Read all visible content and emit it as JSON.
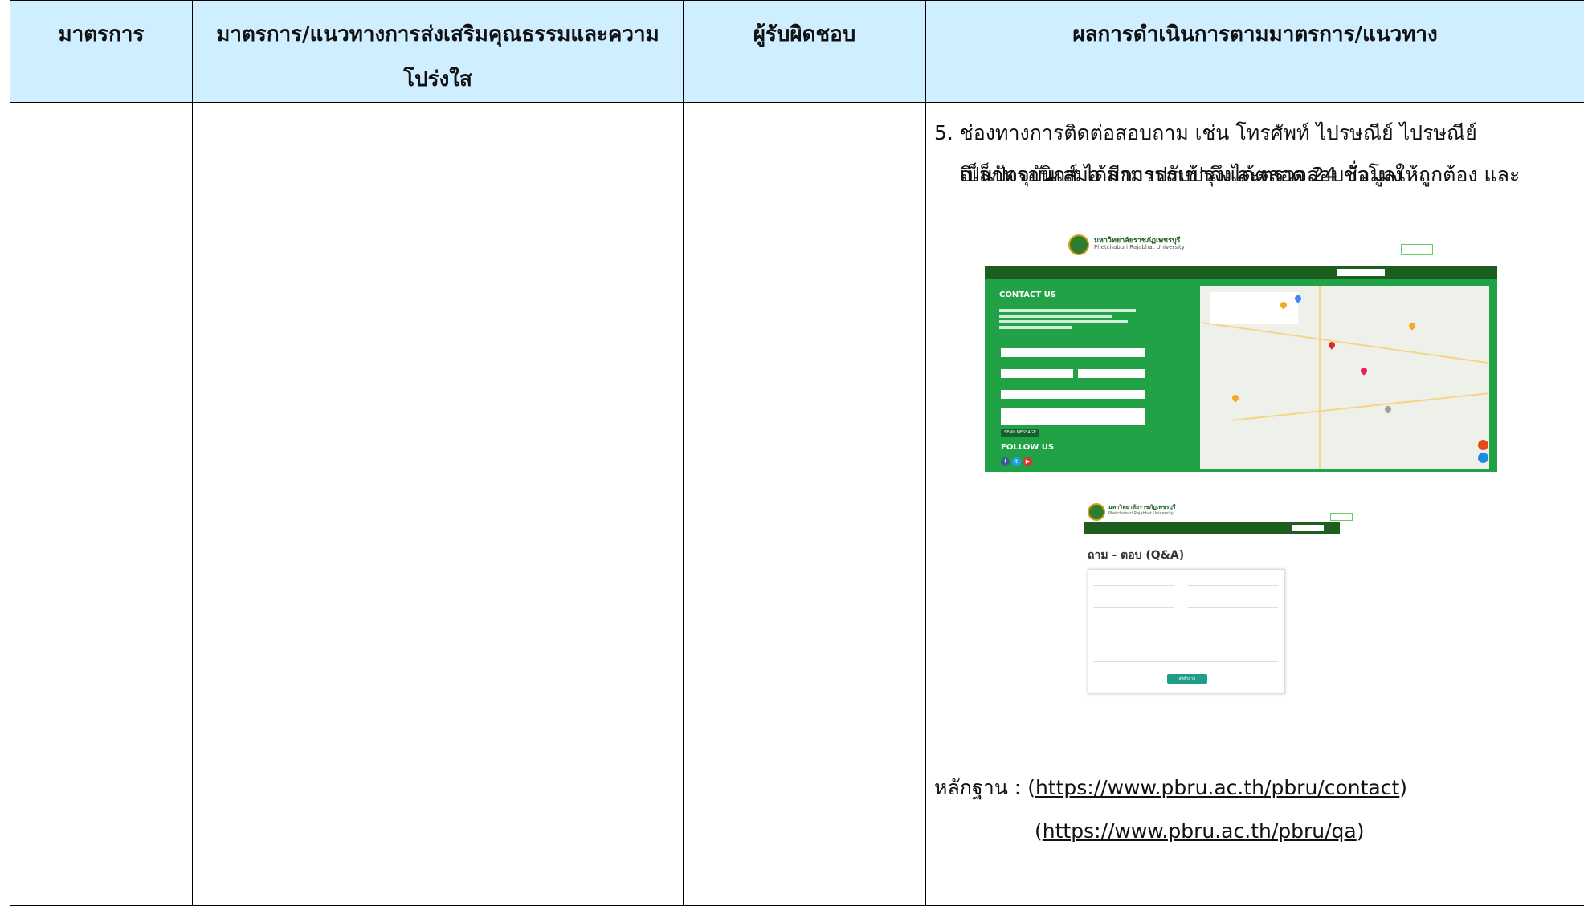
{
  "table": {
    "headers": {
      "col1": "มาตรการ",
      "col2": "มาตรการ/แนวทางการส่งเสริมคุณธรรมและความโปร่งใส",
      "col3": "ผู้รับผิดชอบ",
      "col4": "ผลการดำเนินการตามมาตรการ/แนวทาง"
    },
    "paragraph": {
      "line1": "5. ช่องทางการติดต่อสอบถาม เช่น โทรศัพท์  ไปรษณีย์  ไปรษณีย์",
      "line2": "อิเล็กทรอนิกส์ ได้มีการปรับปรุงและตรวจสอบข้อมูลให้ถูกต้อง และ",
      "line3": "เป็นปัจจุบันเสมอ สามารถเข้าถึงได้ตลอด 24 ชั่วโมง"
    },
    "evidence": {
      "label": "หลักฐาน : ",
      "link1": "https://www.pbru.ac.th/pbru/contact",
      "link2": "https://www.pbru.ac.th/pbru/qa",
      "open": "(",
      "close": ")"
    }
  },
  "contact_shot": {
    "uni_th": "มหาวิทยาลัยราชภัฏเพชรบุรี",
    "uni_en": "Phetchaburi Rajabhat University",
    "title": "CONTACT US",
    "follow": "FOLLOW US",
    "send": "SEND MESSAGE"
  },
  "qa_shot": {
    "uni_th": "มหาวิทยาลัยราชภัฏเพชรบุรี",
    "uni_en": "Phetchaburi Rajabhat University",
    "title": "ถาม - ตอบ (Q&A)",
    "submit": "ส่งคำถาม"
  },
  "colors": {
    "header_bg": "#cfeeff",
    "brand_green": "#22a246",
    "nav_green": "#1b5e20"
  }
}
